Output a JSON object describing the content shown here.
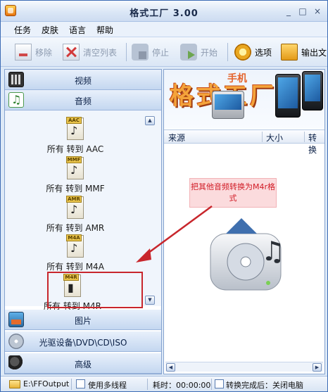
{
  "window": {
    "title": "格式工厂  3.00",
    "controls": [
      "_",
      "□",
      "×"
    ]
  },
  "menu": [
    "任务",
    "皮肤",
    "语言",
    "帮助"
  ],
  "toolbar": {
    "remove": "移除",
    "clear": "清空列表",
    "stop": "停止",
    "start": "开始",
    "options": "选项",
    "output": "输出文"
  },
  "sidebar": {
    "video": "视频",
    "audio": "音频",
    "picture": "图片",
    "disc": "光驱设备\\DVD\\CD\\ISO",
    "advanced": "高级",
    "audio_formats": [
      {
        "tag": "AAC",
        "label": "所有 转到 AAC"
      },
      {
        "tag": "MMF",
        "label": "所有 转到 MMF"
      },
      {
        "tag": "AMR",
        "label": "所有 转到 AMR"
      },
      {
        "tag": "M4A",
        "label": "所有 转到 M4A"
      },
      {
        "tag": "M4R",
        "label": "所有 转到 M4R"
      }
    ]
  },
  "banner": {
    "big_text": "格式工厂",
    "sub_text": "手机"
  },
  "list": {
    "columns": [
      "来源",
      "大小",
      "转换"
    ]
  },
  "annotation": {
    "text": "把其他音频转换为M4r格式",
    "color": "#d11b25"
  },
  "status": {
    "output_path": "E:\\FFOutput",
    "multithread_label": "使用多线程",
    "elapsed": "耗时：00:00:00",
    "after_label": "转换完成后：关闭电脑"
  }
}
